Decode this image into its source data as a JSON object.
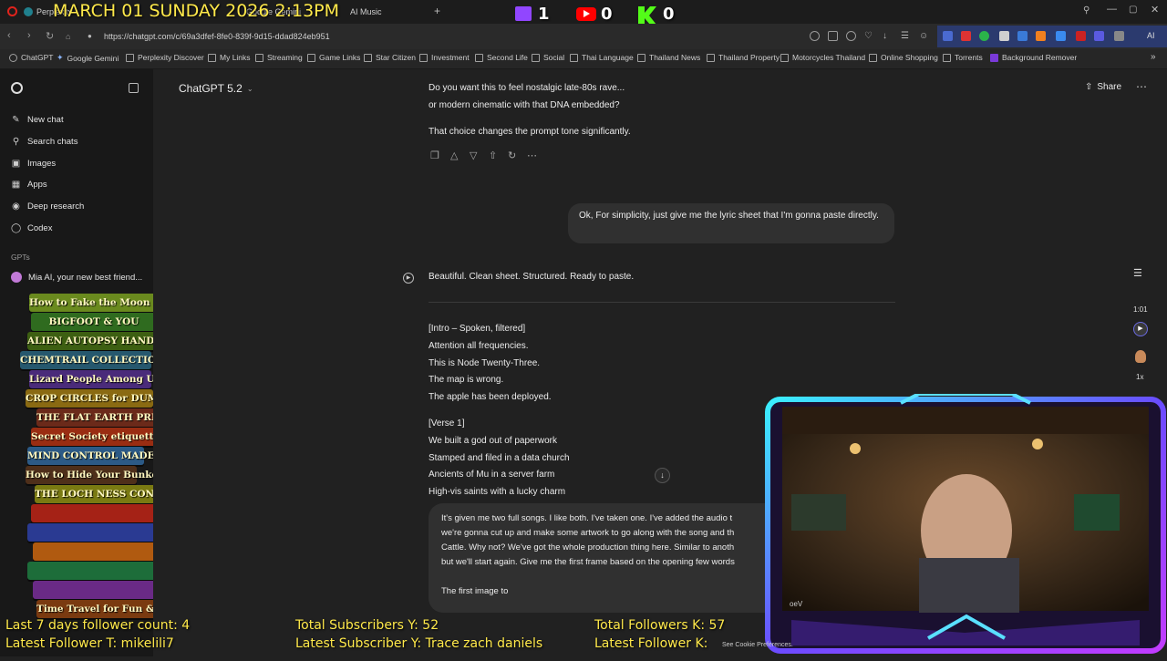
{
  "overlay": {
    "date_time": "MARCH 01 SUNDAY 2026 2:13PM",
    "twitch_count": "1",
    "youtube_count": "0",
    "kick_count": "0",
    "followers_7d": "Last 7 days follower count: 4",
    "latest_follower_t": "Latest Follower T: mikelili7",
    "total_subs_y": "Total Subscribers Y: 52",
    "latest_sub_y": "Latest Subscriber Y: Trace zach daniels",
    "total_followers_k": "Total Followers K: 57",
    "latest_follower_k": "Latest Follower K:",
    "webcam_tag": "oeV",
    "books": [
      {
        "title": "How to Fake the Moon Landing",
        "color": "#6a8a1e"
      },
      {
        "title": "BIGFOOT & YOU",
        "color": "#2f6b1f"
      },
      {
        "title": "ALIEN AUTOPSY HANDBOOK",
        "color": "#3d5f12"
      },
      {
        "title": "CHEMTRAIL COLLECTION GUIDE",
        "color": "#26586e"
      },
      {
        "title": "Lizard People Among Us",
        "color": "#4a2b7a"
      },
      {
        "title": "CROP CIRCLES for DUMMIES",
        "color": "#8a6a12"
      },
      {
        "title": "THE FLAT EARTH PRIMER",
        "color": "#6b2a1a"
      },
      {
        "title": "Secret Society etiquette",
        "color": "#9a2d12"
      },
      {
        "title": "MIND CONTROL MADE EASY",
        "color": "#2c5a86"
      },
      {
        "title": "How to Hide Your Bunker",
        "color": "#4e2f1a"
      },
      {
        "title": "THE LOCH NESS CONSPIRACY",
        "color": "#7a7a12"
      },
      {
        "title": "",
        "color": "#a52216"
      },
      {
        "title": "",
        "color": "#2a3a92"
      },
      {
        "title": "",
        "color": "#b05a10"
      },
      {
        "title": "",
        "color": "#1d6d3a"
      },
      {
        "title": "",
        "color": "#6a2a86"
      },
      {
        "title": "Time Travel for Fun & Profit",
        "color": "#7a3a10"
      }
    ]
  },
  "browser": {
    "tabs": [
      "Perplexity",
      "Google Gemini",
      "AI Music"
    ],
    "url": "https://chatgpt.com/c/69a3dfef-8fe0-839f-9d15-ddad824eb951",
    "bookmarks": [
      "ChatGPT",
      "Google Gemini",
      "Perplexity Discover",
      "My Links",
      "Streaming",
      "Game Links",
      "Star Citizen",
      "Investment",
      "Second Life",
      "Social",
      "Thai Language",
      "Thailand News",
      "Thailand Property",
      "Motorcycles Thailand",
      "Online Shopping",
      "Torrents",
      "Background Remover"
    ]
  },
  "sidebar": {
    "items": [
      "New chat",
      "Search chats",
      "Images",
      "Apps",
      "Deep research",
      "Codex"
    ],
    "gpts_label": "GPTs",
    "gpt_item": "Mia AI, your new best friend..."
  },
  "header": {
    "model": "ChatGPT 5.2",
    "share": "Share"
  },
  "conversation": {
    "prev_line1": "Do you want this to feel nostalgic late-80s rave...",
    "prev_line2": "or modern cinematic with that DNA embedded?",
    "prev_line3": "That choice changes the prompt tone significantly.",
    "user_msg": "Ok, For simplicity, just give me the lyric sheet that I'm gonna paste directly.",
    "reply_intro": "Beautiful. Clean sheet. Structured. Ready to paste.",
    "lyrics": [
      "[Intro – Spoken, filtered]",
      "Attention all frequencies.",
      "This is Node Twenty-Three.",
      "The map is wrong.",
      "The apple has been deployed.",
      "",
      "[Verse 1]",
      "We built a god out of paperwork",
      "Stamped and filed in a data church",
      "Ancients of Mu in a server farm",
      "High-vis saints with a lucky charm"
    ],
    "composer_lines": [
      "It's given me two full songs. I like both. I've taken one. I've added the audio t",
      "we're gonna cut up and make some artwork to go along with the song and th",
      "Cattle. Why not? We've got the whole production thing here. Similar to anoth",
      "but we'll start again. Give me the first frame based on the opening few words",
      "",
      "The first image to"
    ]
  },
  "right_controls": {
    "time": "1:01",
    "speed": "1x"
  },
  "footer_note": "See Cookie Preferences."
}
